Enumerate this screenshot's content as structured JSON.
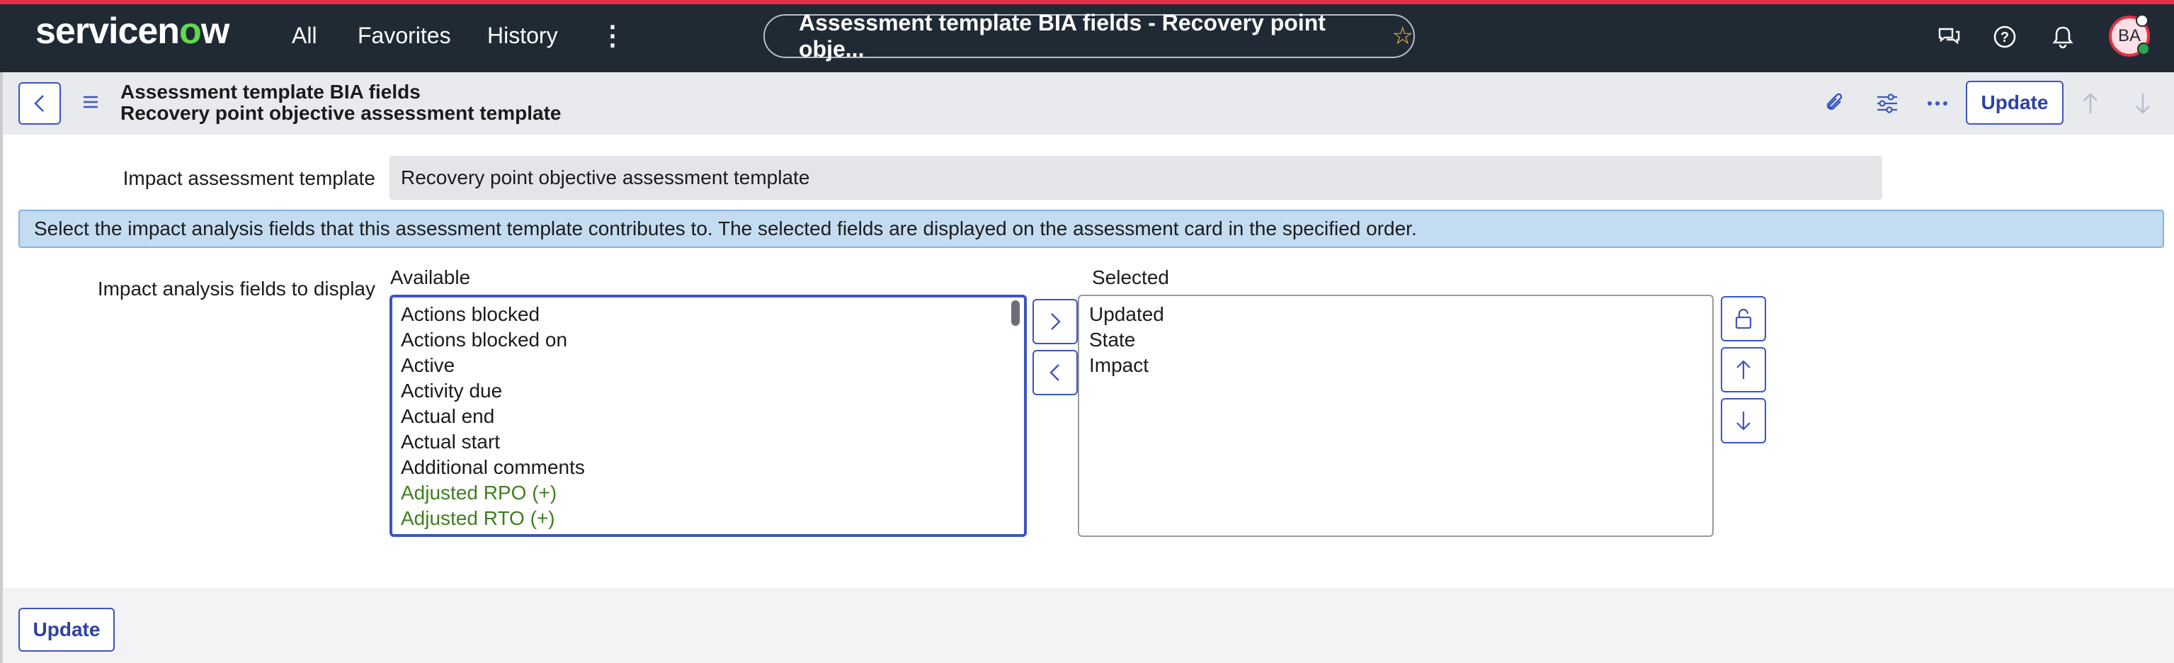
{
  "topnav": {
    "logo": "servicenow",
    "links": [
      "All",
      "Favorites",
      "History"
    ],
    "more_icon": "vertical-dots-icon",
    "page_title": "Assessment template BIA fields - Recovery point obje...",
    "favorite_icon": "star-icon",
    "icons": [
      "chat-icon",
      "help-icon",
      "bell-icon"
    ],
    "avatar_initials": "BA",
    "accent_color": "#e52e47"
  },
  "formbar": {
    "title_line1": "Assessment template BIA fields",
    "title_line2": "Recovery point objective assessment template",
    "icons": [
      "paperclip-icon",
      "sliders-icon",
      "more-horizontal-icon"
    ],
    "update_label": "Update"
  },
  "form": {
    "template_label": "Impact assessment template",
    "template_value": "Recovery point objective assessment template",
    "info_message": "Select the impact analysis fields that this assessment template contributes to. The selected fields are displayed on the assessment card in the specified order.",
    "fields_label": "Impact analysis fields to display",
    "available_heading": "Available",
    "selected_heading": "Selected",
    "available": [
      {
        "label": "Actions blocked",
        "extended": false
      },
      {
        "label": "Actions blocked on",
        "extended": false
      },
      {
        "label": "Active",
        "extended": false
      },
      {
        "label": "Activity due",
        "extended": false
      },
      {
        "label": "Actual end",
        "extended": false
      },
      {
        "label": "Actual start",
        "extended": false
      },
      {
        "label": "Additional comments",
        "extended": false
      },
      {
        "label": "Adjusted RPO (+)",
        "extended": true
      },
      {
        "label": "Adjusted RTO (+)",
        "extended": true
      }
    ],
    "selected": [
      "Updated",
      "State",
      "Impact"
    ]
  },
  "footer": {
    "update_label": "Update"
  }
}
